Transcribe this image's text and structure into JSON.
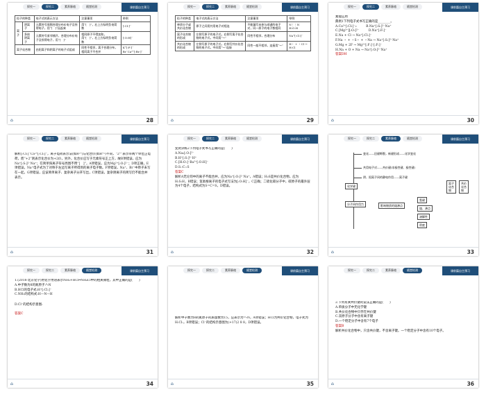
{
  "header": {
    "tabs": [
      "探究一",
      "探究二",
      "素养脉络",
      "随堂检测"
    ],
    "ribbon": "课前篇自主预习"
  },
  "slides": [
    {
      "page": "28",
      "active_tab": 1,
      "table_headers": [
        "粒子的种类",
        "电子式的表示方法",
        "注意事项",
        "举例"
      ],
      "rows": [
        [
          "离子",
          "阴离子",
          "元素符号周围合理分布价电子及所得电子，用“[　]”括起来",
          "用“[　]”，右上方标明负电荷数",
          "[:Cl:]⁻"
        ],
        [
          "",
          "多核阴离子",
          "元素符号紧邻铺开，合理分布价电子及所得电子，用“[　]”",
          "相同原子不得加和，用“[　]”，右上方标明负电荷数",
          "[:O:H]⁻"
        ],
        [
          "离子化合物",
          "",
          "由阳离子和阴离子的电子式组成",
          "同性不相邻，离子合理分布，相同离子不合并",
          "K⁺[:F:]⁻  Br⁻Ca²⁺[:Br:]⁻"
        ]
      ]
    },
    {
      "page": "29",
      "active_tab": 1,
      "table_headers": [
        "粒子的种类",
        "电子式的表示方法",
        "注意事项",
        "举例"
      ],
      "rows": [
        [
          "单质分子或共价化合物",
          "原子之间用共用电子对相连",
          "不能漏写未参与成键的电子对，同一原子的电子数相同",
          "N⋮⋮N  H:O:H"
        ],
        [
          "离子化合物的形成",
          "左侧写原子的电子式，右侧写离子化合物的电子式，中间用“→”",
          "同性不相邻，合理分布",
          "Na⁺[:Cl:]⁻"
        ],
        [
          "共价化合物的形成",
          "左侧写原子的电子式，右侧写共价化合物的电子式，中间用“→”连接",
          "同性一般不相邻，连接用“→”",
          "H・ + ・Cl → H:Cl"
        ]
      ]
    },
    {
      "page": "30",
      "active_tab": 1,
      "lines": [
        "素能应用",
        "典例1下列电子式书写正确的是________。",
        "A.Ca²⁺[:Cl:]⁻₂　　　B.Na⁺[:S:]²⁻Na⁺",
        "C.[Mg²⁺][:O:]²⁻　　　D.Na⁺[:F:]⁻",
        "E.Na + Cl → Na⁺[:Cl:]⁻",
        "F.Na ・ + ・S・ + ・Na → Na⁺[:S:]²⁻Na⁺",
        "G.Mg + 2F → Mg²⁺[:F:]⁻[:F:]⁻",
        "H.Na + O + Na → Na⁺[:O:]²⁻Na⁺"
      ],
      "answer": "答案DH"
    },
    {
      "page": "31",
      "active_tab": 1,
      "text": "解析[:Cl:]⁻Ca²⁺[:Cl:]⁻，离子电荷表示法(如R²⁺)与化合价(如R⁺²)不同，“2⁺”表示带两个单位正电荷，而“+2”则表示化合价为+2价，另外，化合价应写于元素符号正上方，故B项错误，应为Na⁺[:S:]²⁻Na⁺；在简单阳离子符号周围不用“[　]”，A项错误，应为Mg²⁺[:O:]²⁻；D项正确，E项错误，Na⁺电子式为了对称于左边写离子所得到的离子电子数。F项错误，Na⁺、Br⁻中原子未写在一起，G项错误，应该简单离子、复杂离子分开写出，C项错误，复杂阴离子的简写仍不能合并表示。"
    },
    {
      "page": "32",
      "active_tab": 1,
      "lines": [
        "变式训练2下列电子式书写正确的是(　　)",
        "A.Na₂[:O:]²⁻",
        "B.H⁺[:S:]²⁻H⁺",
        "C.[H:O:]⁻Ba²⁺[:O:H]⁻",
        "D.S::C::S"
      ],
      "answer": "答案C",
      "analysis": "解析A无论何中的离子不能合并，应为Na⁺[:O:]²⁻Na⁺，A错误；H₂S是共价化合物，应为H:S:H，B错误；氢氧根离子的电子式写法为[:O:H]⁻，C正确；二硫化碳分子中，碳原子的最外层为4个电子，结构式为S=C=S，D错误。"
    },
    {
      "page": "33",
      "active_tab": 2,
      "center": "化学键",
      "branch1": "变化——旧键断裂，新键形成——化学变化",
      "branch2": "共用电子对——共价键(非极性键、极性键)",
      "branch3": "阴、阳离子间的静电作用——离子键",
      "side": "离子化合物",
      "side2": "共价化合物",
      "box1": "分子间作用力",
      "box2": "影响物质的熔沸点",
      "box3": "氢键",
      "box4": "熔、沸点",
      "box5": "溶解性",
      "box6": "密度"
    },
    {
      "page": "34",
      "active_tab": 3,
      "lines": [
        "1.(2018·北京化学)用化学用语表示NH₃+HCl═NH₄Cl中的相关微粒，其中正确的是(　　)",
        "A.中子数为8的氮原子:⁸₇N",
        "B.HCl的电子式:H⁺[:Cl:]⁻",
        "C.NH₃的结构式:H—N—H",
        "D.Cl⁻的结构示意图:"
      ],
      "answer": "答案C"
    },
    {
      "page": "35",
      "active_tab": 3,
      "analysis": "解析中子数为8的氮原子的质量数为15，应表示为¹⁵₇N，A项错误；HCl为共价化合物，电子式为H:Cl:，B项错误；Cl⁻的结构示意图为(+17)2 8 8，D项错误。"
    },
    {
      "page": "36",
      "active_tab": 3,
      "lines": [
        "2.下列有关共价键的说法正确的是(　　)",
        "A.单质分子中无化学键",
        "B.共价化合物中只存在共价键",
        "C.双原子分子中含有离子键",
        "D.一个稳定分子中含有7个电子"
      ],
      "answer": "答案B",
      "analysis": "解析共价化合物中，只含共价键，不含离子键。一个稳定分子中含有10个电子。"
    }
  ]
}
